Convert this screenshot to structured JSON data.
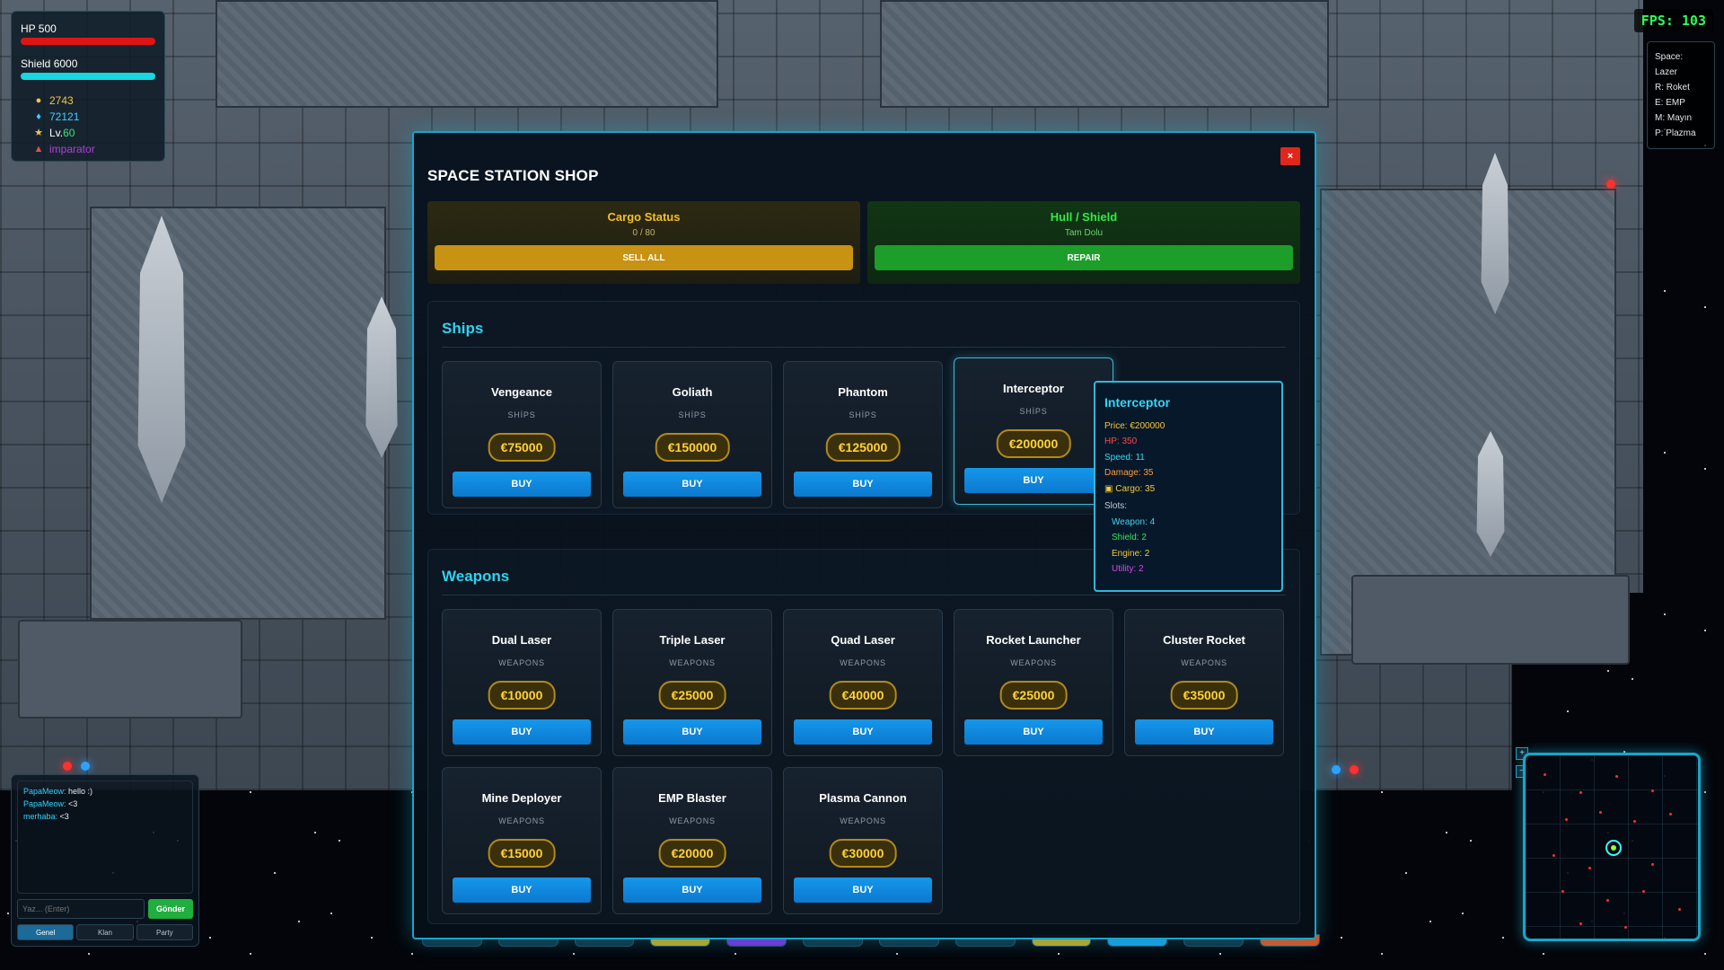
{
  "hud": {
    "hp_label": "HP 500",
    "shield_label": "Shield 6000",
    "gold": "2743",
    "gems": "72121",
    "level_prefix": "Lv.",
    "level": "60",
    "title": "imparator",
    "colors": {
      "hp": "#e01414",
      "shield": "#19d7e0",
      "gold": "#f5c542",
      "gems": "#3fd0ff",
      "level": "#3ae27a",
      "title": "#b23fd9"
    }
  },
  "fps": "FPS: 103",
  "keys": [
    "Space: Lazer",
    "R: Roket",
    "E: EMP",
    "M: Mayın",
    "P: Plazma"
  ],
  "chat": {
    "messages": [
      {
        "name": "PapaMeow:",
        "text": " hello :)"
      },
      {
        "name": "PapaMeow:",
        "text": " <3"
      },
      {
        "name": "merhaba:",
        "text": " <3"
      }
    ],
    "placeholder": "Yaz... (Enter)",
    "send": "Gönder",
    "tabs": [
      "Genel",
      "Klan",
      "Party"
    ]
  },
  "shop": {
    "title": "SPACE STATION SHOP",
    "close": "×",
    "cargo": {
      "title": "Cargo Status",
      "value": "0 / 80",
      "button": "SELL ALL"
    },
    "hull": {
      "title": "Hull / Shield",
      "value": "Tam Dolu",
      "button": "REPAIR"
    },
    "ships": {
      "heading": "Ships",
      "items": [
        {
          "name": "Vengeance",
          "category": "SHİPS",
          "price": "€75000",
          "buy": "BUY"
        },
        {
          "name": "Goliath",
          "category": "SHİPS",
          "price": "€150000",
          "buy": "BUY"
        },
        {
          "name": "Phantom",
          "category": "SHİPS",
          "price": "€125000",
          "buy": "BUY"
        },
        {
          "name": "Interceptor",
          "category": "SHİPS",
          "price": "€200000",
          "buy": "BUY"
        }
      ]
    },
    "weapons": {
      "heading": "Weapons",
      "items": [
        {
          "name": "Dual Laser",
          "category": "WEAPONS",
          "price": "€10000",
          "buy": "BUY"
        },
        {
          "name": "Triple Laser",
          "category": "WEAPONS",
          "price": "€25000",
          "buy": "BUY"
        },
        {
          "name": "Quad Laser",
          "category": "WEAPONS",
          "price": "€40000",
          "buy": "BUY"
        },
        {
          "name": "Rocket Launcher",
          "category": "WEAPONS",
          "price": "€25000",
          "buy": "BUY"
        },
        {
          "name": "Cluster Rocket",
          "category": "WEAPONS",
          "price": "€35000",
          "buy": "BUY"
        },
        {
          "name": "Mine Deployer",
          "category": "WEAPONS",
          "price": "€15000",
          "buy": "BUY"
        },
        {
          "name": "EMP Blaster",
          "category": "WEAPONS",
          "price": "€20000",
          "buy": "BUY"
        },
        {
          "name": "Plasma Cannon",
          "category": "WEAPONS",
          "price": "€30000",
          "buy": "BUY"
        }
      ]
    },
    "tooltip": {
      "title": "Interceptor",
      "price": "Price: €200000",
      "hp": "HP: 350",
      "speed": "Speed: 11",
      "damage": "Damage: 35",
      "cargo": "Cargo: 35",
      "slots_label": "Slots:",
      "weapon": "Weapon: 4",
      "shield": "Shield: 2",
      "engine": "Engine: 2",
      "utility": "Utility: 2"
    }
  }
}
